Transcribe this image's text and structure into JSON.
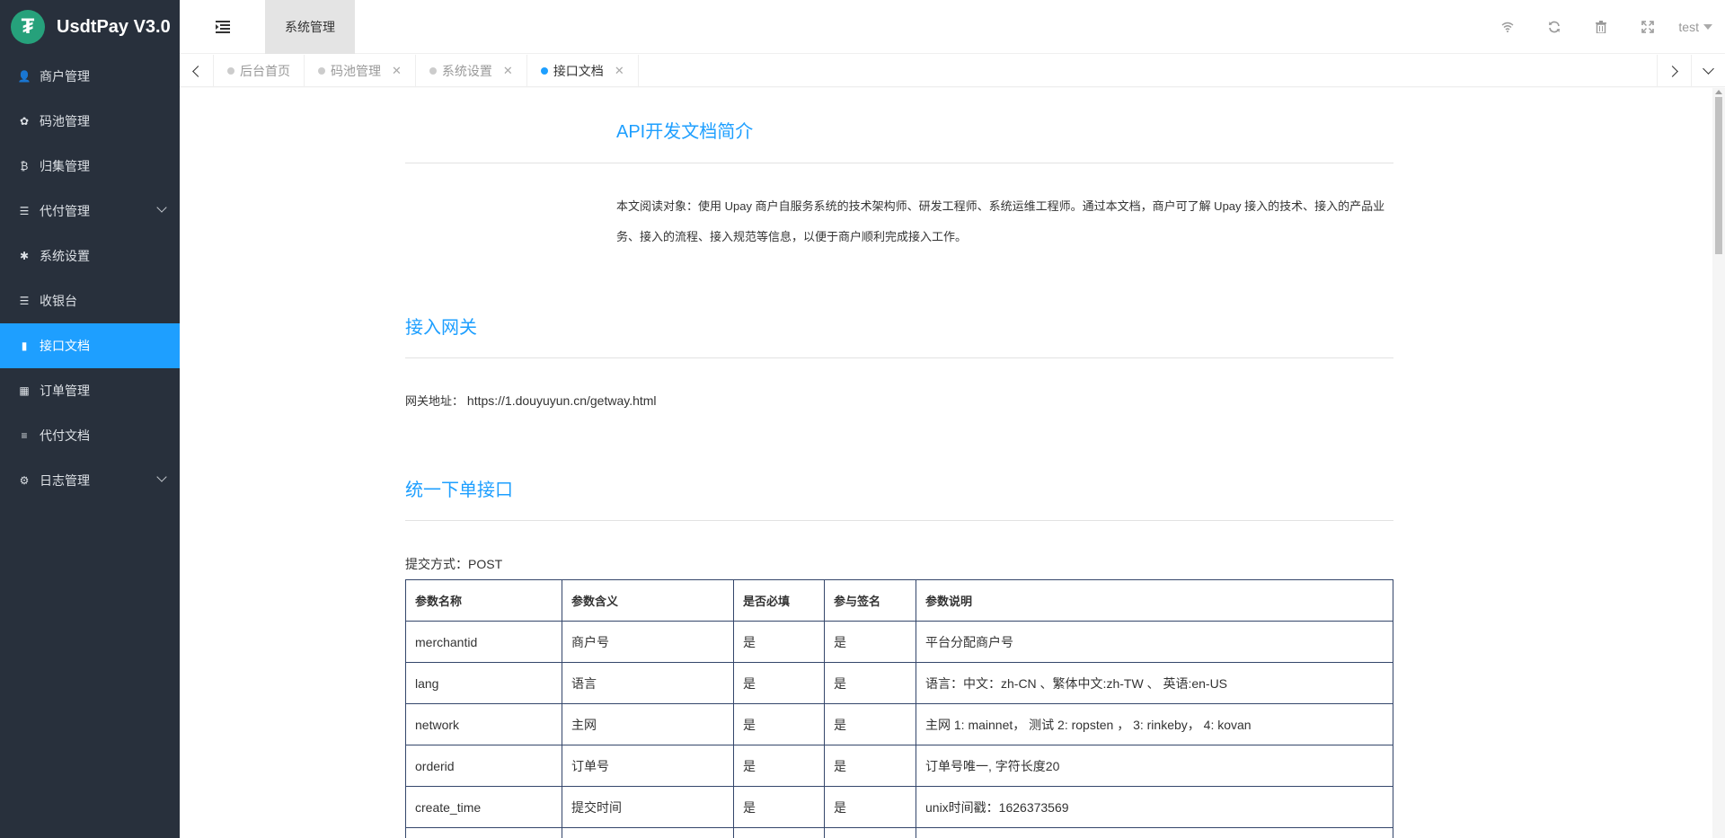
{
  "app": {
    "title": "UsdtPay V3.0",
    "logo_glyph": "₮"
  },
  "sidebar": {
    "items": [
      {
        "label": "商户管理",
        "icon": "user-icon",
        "glyph": "👤",
        "has_arrow": false
      },
      {
        "label": "码池管理",
        "icon": "android-icon",
        "glyph": "✿",
        "has_arrow": false
      },
      {
        "label": "归集管理",
        "icon": "bitcoin-icon",
        "glyph": "₿",
        "has_arrow": false
      },
      {
        "label": "代付管理",
        "icon": "list-icon",
        "glyph": "☰",
        "has_arrow": true
      },
      {
        "label": "系统设置",
        "icon": "asterisk-icon",
        "glyph": "✱",
        "has_arrow": false
      },
      {
        "label": "收银台",
        "icon": "list-icon",
        "glyph": "☰",
        "has_arrow": false
      },
      {
        "label": "接口文档",
        "icon": "book-icon",
        "glyph": "▮",
        "has_arrow": false,
        "active": true
      },
      {
        "label": "订单管理",
        "icon": "calculator-icon",
        "glyph": "▦",
        "has_arrow": false
      },
      {
        "label": "代付文档",
        "icon": "align-left-icon",
        "glyph": "≡",
        "has_arrow": false
      },
      {
        "label": "日志管理",
        "icon": "gear-icon",
        "glyph": "⚙",
        "has_arrow": true
      }
    ]
  },
  "header": {
    "fold_icon": "menu-fold-icon",
    "tab_label": "系统管理",
    "icons": [
      "wifi-icon",
      "refresh-icon",
      "trash-icon",
      "fullscreen-icon"
    ],
    "user": "test"
  },
  "tabs": [
    {
      "label": "后台首页",
      "closable": false,
      "active": false
    },
    {
      "label": "码池管理",
      "closable": true,
      "active": false
    },
    {
      "label": "系统设置",
      "closable": true,
      "active": false
    },
    {
      "label": "接口文档",
      "closable": true,
      "active": true
    }
  ],
  "doc": {
    "intro_title": "API开发文档简介",
    "intro_text": "本文阅读对象：使用 Upay 商户自服务系统的技术架构师、研发工程师、系统运维工程师。通过本文档，商户可了解 Upay 接入的技术、接入的产品业务、接入的流程、接入规范等信息，以便于商户顺利完成接入工作。",
    "gateway_title": "接入网关",
    "gateway_label": "网关地址：",
    "gateway_url": "https://1.douyuyun.cn/getway.html",
    "order_title": "统一下单接口",
    "submit_method": "提交方式：POST",
    "table": {
      "headers": [
        "参数名称",
        "参数含义",
        "是否必填",
        "参与签名",
        "参数说明"
      ],
      "rows": [
        [
          "merchantid",
          "商户号",
          "是",
          "是",
          "平台分配商户号"
        ],
        [
          "lang",
          "语言",
          "是",
          "是",
          "语言：中文：zh-CN 、繁体中文:zh-TW 、 英语:en-US"
        ],
        [
          "network",
          "主网",
          "是",
          "是",
          "主网 1: mainnet， 测试 2: ropsten ， 3: rinkeby， 4: kovan"
        ],
        [
          "orderid",
          "订单号",
          "是",
          "是",
          "订单号唯一, 字符长度20"
        ],
        [
          "create_time",
          "提交时间",
          "是",
          "是",
          "unix时间戳：1626373569"
        ],
        [
          "",
          "",
          "",
          "",
          ""
        ]
      ]
    }
  }
}
